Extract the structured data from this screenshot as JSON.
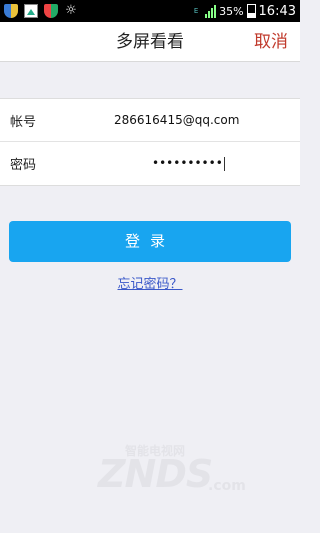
{
  "status_bar": {
    "icons": [
      "shield-icon",
      "picture-icon",
      "shield-icon",
      "brightness-icon"
    ],
    "network_badge": "E",
    "battery_percent": "35%",
    "time": "16:43"
  },
  "header": {
    "title": "多屏看看",
    "cancel_label": "取消"
  },
  "form": {
    "account_label": "帐号",
    "account_value": "286616415@qq.com",
    "password_label": "密码",
    "password_value": "••••••••••"
  },
  "login_label": "登录",
  "forgot_label": "忘记密码？",
  "watermark": {
    "sub": "智能电视网",
    "main": "ZNDS",
    "suffix": ".com"
  },
  "colors": {
    "accent": "#18a5f0",
    "cancel": "#c0392b",
    "link": "#3a58c9",
    "background": "#efeff4"
  }
}
